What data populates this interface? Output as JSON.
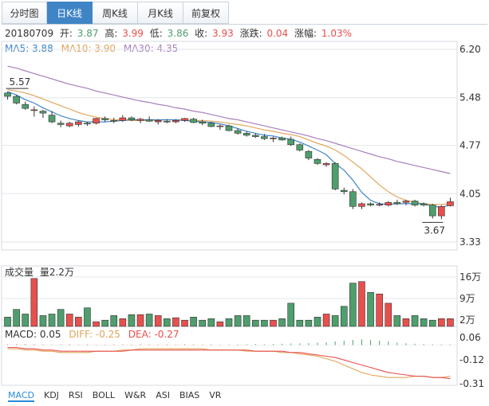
{
  "tabs": [
    {
      "label": "分时图",
      "active": false
    },
    {
      "label": "日K线",
      "active": true
    },
    {
      "label": "周K线",
      "active": false
    },
    {
      "label": "月K线",
      "active": false
    },
    {
      "label": "前复权",
      "active": false
    }
  ],
  "info": {
    "date": "20180709",
    "open_label": "开:",
    "open": "3.87",
    "high_label": "高:",
    "high": "3.99",
    "low_label": "低:",
    "low": "3.86",
    "close_label": "收:",
    "close": "3.93",
    "change_label": "涨跌:",
    "change": "0.04",
    "pct_label": "涨幅:",
    "pct": "1.03%"
  },
  "ma": {
    "ma5": "MA5: 3.88",
    "ma10": "MA10: 3.90",
    "ma30": "MA30: 4.35"
  },
  "volume": {
    "title": "成交量",
    "value": "量2.2万"
  },
  "macd": {
    "macd": "MACD: 0.05",
    "diff": "DIFF: -0.25",
    "dea": "DEA: -0.27"
  },
  "bottom_tabs": [
    "MACD",
    "KDJ",
    "RSI",
    "BOLL",
    "W&R",
    "ASI",
    "BIAS",
    "VR"
  ],
  "colors": {
    "up": "#e8504d",
    "down": "#4f9e6d",
    "ma5": "#3f85c6",
    "ma10": "#e2a55a",
    "ma30": "#a77fc0",
    "grid": "#e2e6ea"
  },
  "chart_data": {
    "type": "candlestick",
    "price_axis_ticks": [
      "6.20",
      "5.48",
      "4.77",
      "4.05",
      "3.33"
    ],
    "price_range": [
      3.33,
      6.2
    ],
    "annotations": {
      "high": "5.57",
      "low": "3.67"
    },
    "candles": [
      [
        5.55,
        5.57,
        5.45,
        5.5
      ],
      [
        5.5,
        5.52,
        5.38,
        5.4
      ],
      [
        5.38,
        5.42,
        5.3,
        5.32
      ],
      [
        5.3,
        5.35,
        5.2,
        5.3
      ],
      [
        5.28,
        5.3,
        5.18,
        5.25
      ],
      [
        5.22,
        5.28,
        5.1,
        5.12
      ],
      [
        5.1,
        5.14,
        5.04,
        5.08
      ],
      [
        5.06,
        5.12,
        5.04,
        5.1
      ],
      [
        5.08,
        5.14,
        5.05,
        5.12
      ],
      [
        5.1,
        5.12,
        5.06,
        5.09
      ],
      [
        5.1,
        5.18,
        5.08,
        5.17
      ],
      [
        5.17,
        5.2,
        5.12,
        5.15
      ],
      [
        5.14,
        5.18,
        5.1,
        5.13
      ],
      [
        5.14,
        5.22,
        5.12,
        5.18
      ],
      [
        5.18,
        5.2,
        5.13,
        5.15
      ],
      [
        5.14,
        5.18,
        5.1,
        5.16
      ],
      [
        5.15,
        5.2,
        5.12,
        5.13
      ],
      [
        5.12,
        5.16,
        5.08,
        5.14
      ],
      [
        5.13,
        5.16,
        5.1,
        5.12
      ],
      [
        5.12,
        5.16,
        5.1,
        5.14
      ],
      [
        5.14,
        5.18,
        5.12,
        5.17
      ],
      [
        5.16,
        5.18,
        5.1,
        5.11
      ],
      [
        5.12,
        5.15,
        5.07,
        5.1
      ],
      [
        5.1,
        5.12,
        5.04,
        5.05
      ],
      [
        5.05,
        5.08,
        5.0,
        5.06
      ],
      [
        5.06,
        5.08,
        4.98,
        4.99
      ],
      [
        4.99,
        5.02,
        4.93,
        4.95
      ],
      [
        4.95,
        4.98,
        4.9,
        4.92
      ],
      [
        4.92,
        4.95,
        4.88,
        4.9
      ],
      [
        4.9,
        4.94,
        4.85,
        4.87
      ],
      [
        4.87,
        4.9,
        4.82,
        4.88
      ],
      [
        4.88,
        4.9,
        4.84,
        4.85
      ],
      [
        4.86,
        4.9,
        4.76,
        4.78
      ],
      [
        4.78,
        4.8,
        4.68,
        4.7
      ],
      [
        4.68,
        4.7,
        4.55,
        4.58
      ],
      [
        4.56,
        4.58,
        4.48,
        4.5
      ],
      [
        4.48,
        4.52,
        4.45,
        4.5
      ],
      [
        4.5,
        4.52,
        4.1,
        4.12
      ],
      [
        4.1,
        4.14,
        4.04,
        4.08
      ],
      [
        4.08,
        4.12,
        3.82,
        3.86
      ],
      [
        3.86,
        3.92,
        3.82,
        3.9
      ],
      [
        3.9,
        3.92,
        3.86,
        3.88
      ],
      [
        3.88,
        3.92,
        3.86,
        3.89
      ],
      [
        3.88,
        3.94,
        3.86,
        3.92
      ],
      [
        3.92,
        3.96,
        3.88,
        3.9
      ],
      [
        3.92,
        3.96,
        3.88,
        3.94
      ],
      [
        3.94,
        3.96,
        3.86,
        3.88
      ],
      [
        3.9,
        3.92,
        3.86,
        3.88
      ],
      [
        3.88,
        3.9,
        3.68,
        3.72
      ],
      [
        3.72,
        3.88,
        3.67,
        3.86
      ],
      [
        3.87,
        3.99,
        3.86,
        3.93
      ]
    ],
    "ma5": [
      5.57,
      5.52,
      5.45,
      5.4,
      5.33,
      5.27,
      5.21,
      5.17,
      5.14,
      5.12,
      5.12,
      5.12,
      5.13,
      5.14,
      5.15,
      5.15,
      5.15,
      5.15,
      5.15,
      5.15,
      5.14,
      5.13,
      5.12,
      5.11,
      5.09,
      5.06,
      5.02,
      4.98,
      4.95,
      4.92,
      4.91,
      4.88,
      4.86,
      4.82,
      4.76,
      4.7,
      4.63,
      4.5,
      4.4,
      4.25,
      4.07,
      3.95,
      3.9,
      3.89,
      3.9,
      3.9,
      3.9,
      3.9,
      3.86,
      3.85,
      3.88
    ],
    "ma10": [
      5.6,
      5.58,
      5.55,
      5.51,
      5.46,
      5.41,
      5.36,
      5.31,
      5.26,
      5.22,
      5.19,
      5.17,
      5.15,
      5.15,
      5.14,
      5.14,
      5.14,
      5.15,
      5.15,
      5.15,
      5.15,
      5.14,
      5.14,
      5.13,
      5.12,
      5.1,
      5.08,
      5.06,
      5.03,
      5.0,
      4.98,
      4.95,
      4.93,
      4.9,
      4.85,
      4.8,
      4.76,
      4.7,
      4.62,
      4.52,
      4.42,
      4.3,
      4.18,
      4.08,
      4.0,
      3.95,
      3.92,
      3.9,
      3.89,
      3.89,
      3.9
    ],
    "ma30": [
      5.95,
      5.92,
      5.88,
      5.84,
      5.8,
      5.76,
      5.72,
      5.68,
      5.65,
      5.62,
      5.58,
      5.55,
      5.52,
      5.49,
      5.46,
      5.43,
      5.41,
      5.38,
      5.36,
      5.33,
      5.31,
      5.28,
      5.26,
      5.23,
      5.2,
      5.17,
      5.15,
      5.12,
      5.09,
      5.06,
      5.03,
      5.0,
      4.97,
      4.94,
      4.91,
      4.87,
      4.84,
      4.8,
      4.76,
      4.72,
      4.68,
      4.64,
      4.6,
      4.57,
      4.53,
      4.5,
      4.47,
      4.44,
      4.41,
      4.38,
      4.35
    ],
    "volume_axis_ticks": [
      "16万",
      "9万",
      "2万"
    ],
    "volume_range": [
      0,
      17
    ],
    "volumes": [
      3.0,
      5.5,
      4.0,
      15.5,
      3.5,
      4.0,
      5.5,
      4.0,
      3.0,
      6.0,
      1.5,
      2.0,
      3.5,
      2.5,
      3.8,
      3.8,
      4.0,
      3.5,
      2.5,
      2.8,
      2.0,
      3.0,
      2.0,
      2.5,
      1.5,
      2.5,
      3.5,
      3.5,
      2.0,
      2.0,
      2.0,
      2.5,
      7.5,
      2.0,
      2.0,
      3.0,
      4.0,
      3.5,
      6.5,
      14.0,
      14.5,
      11.0,
      10.5,
      7.5,
      3.5,
      2.5,
      3.5,
      2.5,
      2.0,
      2.5,
      2.5
    ],
    "macd_axis_ticks": [
      "0.06",
      "-0.12",
      "-0.31"
    ],
    "macd_range": [
      -0.31,
      0.06
    ],
    "macd_hist": [
      0.005,
      0.006,
      0.008,
      0.006,
      0.005,
      0.004,
      0.005,
      0.006,
      0.004,
      0.005,
      0.003,
      0.004,
      0.005,
      0.005,
      0.004,
      0.006,
      0.005,
      0.004,
      0.005,
      0.004,
      0.006,
      0.005,
      0.004,
      0.005,
      0.003,
      0.004,
      0.005,
      0.006,
      0.008,
      0.006,
      0.008,
      0.01,
      0.012,
      0.013,
      0.015,
      0.018,
      0.022,
      0.028,
      0.034,
      0.04,
      0.045,
      0.04,
      0.035,
      0.028,
      0.02,
      0.014,
      0.01,
      0.008,
      0.006,
      0.005,
      0.005
    ],
    "macd_dif": [
      -0.03,
      -0.03,
      -0.04,
      -0.04,
      -0.05,
      -0.05,
      -0.06,
      -0.06,
      -0.06,
      -0.06,
      -0.05,
      -0.05,
      -0.05,
      -0.04,
      -0.04,
      -0.03,
      -0.03,
      -0.03,
      -0.03,
      -0.03,
      -0.03,
      -0.03,
      -0.03,
      -0.04,
      -0.04,
      -0.04,
      -0.04,
      -0.05,
      -0.05,
      -0.05,
      -0.05,
      -0.06,
      -0.06,
      -0.07,
      -0.08,
      -0.09,
      -0.11,
      -0.13,
      -0.16,
      -0.19,
      -0.22,
      -0.24,
      -0.25,
      -0.26,
      -0.26,
      -0.26,
      -0.25,
      -0.25,
      -0.26,
      -0.26,
      -0.25
    ],
    "macd_dea": [
      -0.02,
      -0.02,
      -0.03,
      -0.03,
      -0.04,
      -0.04,
      -0.05,
      -0.05,
      -0.05,
      -0.05,
      -0.05,
      -0.05,
      -0.05,
      -0.05,
      -0.04,
      -0.04,
      -0.04,
      -0.04,
      -0.04,
      -0.04,
      -0.04,
      -0.04,
      -0.04,
      -0.04,
      -0.04,
      -0.04,
      -0.04,
      -0.04,
      -0.05,
      -0.05,
      -0.05,
      -0.05,
      -0.06,
      -0.06,
      -0.07,
      -0.08,
      -0.09,
      -0.1,
      -0.12,
      -0.14,
      -0.16,
      -0.18,
      -0.2,
      -0.22,
      -0.23,
      -0.24,
      -0.25,
      -0.25,
      -0.26,
      -0.26,
      -0.27
    ]
  }
}
